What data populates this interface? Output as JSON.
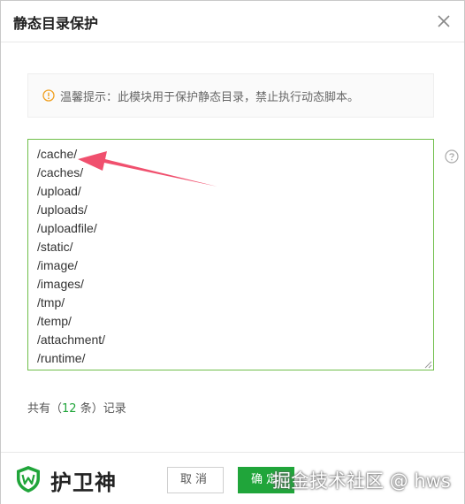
{
  "dialog": {
    "title": "静态目录保护",
    "tip": "温馨提示：此模块用于保护静态目录，禁止执行动态脚本。",
    "directories": [
      "/cache/",
      "/caches/",
      "/upload/",
      "/uploads/",
      "/uploadfile/",
      "/static/",
      "/image/",
      "/images/",
      "/tmp/",
      "/temp/",
      "/attachment/",
      "/runtime/"
    ],
    "count": {
      "prefix": "共有（",
      "value": "12",
      "suffix": " 条）记录"
    }
  },
  "footer": {
    "brand": "护卫神",
    "cancel_label": "取消",
    "ok_label": "确定"
  },
  "watermark": "掘金技术社区 @ hws",
  "colors": {
    "accent": "#20a53a",
    "textarea_border": "#6fbf4a",
    "tip_icon": "#f0a020",
    "arrow": "#f0506e"
  },
  "icons": {
    "close": "close-icon",
    "tip": "info-circle-icon",
    "help": "question-circle-icon",
    "logo": "shield-w-icon"
  }
}
